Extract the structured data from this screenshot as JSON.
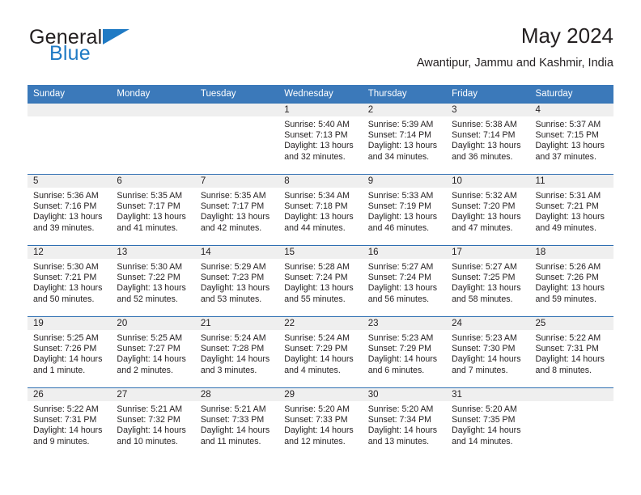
{
  "brand": {
    "name_part1": "General",
    "name_part2": "Blue",
    "triangle_color": "#1f7ac4"
  },
  "header": {
    "title": "May 2024",
    "subtitle": "Awantipur, Jammu and Kashmir, India"
  },
  "theme": {
    "header_blue": "#3b79ba",
    "row_border_blue": "#2f6fb2",
    "daynum_band": "#efefef",
    "text": "#231f20"
  },
  "weekday_headers": [
    "Sunday",
    "Monday",
    "Tuesday",
    "Wednesday",
    "Thursday",
    "Friday",
    "Saturday"
  ],
  "weeks": [
    [
      {
        "day": "",
        "sunrise": "",
        "sunset": "",
        "daylight_line1": "",
        "daylight_line2": "",
        "empty": true
      },
      {
        "day": "",
        "sunrise": "",
        "sunset": "",
        "daylight_line1": "",
        "daylight_line2": "",
        "empty": true
      },
      {
        "day": "",
        "sunrise": "",
        "sunset": "",
        "daylight_line1": "",
        "daylight_line2": "",
        "empty": true
      },
      {
        "day": "1",
        "sunrise": "Sunrise: 5:40 AM",
        "sunset": "Sunset: 7:13 PM",
        "daylight_line1": "Daylight: 13 hours",
        "daylight_line2": "and 32 minutes.",
        "empty": false
      },
      {
        "day": "2",
        "sunrise": "Sunrise: 5:39 AM",
        "sunset": "Sunset: 7:14 PM",
        "daylight_line1": "Daylight: 13 hours",
        "daylight_line2": "and 34 minutes.",
        "empty": false
      },
      {
        "day": "3",
        "sunrise": "Sunrise: 5:38 AM",
        "sunset": "Sunset: 7:14 PM",
        "daylight_line1": "Daylight: 13 hours",
        "daylight_line2": "and 36 minutes.",
        "empty": false
      },
      {
        "day": "4",
        "sunrise": "Sunrise: 5:37 AM",
        "sunset": "Sunset: 7:15 PM",
        "daylight_line1": "Daylight: 13 hours",
        "daylight_line2": "and 37 minutes.",
        "empty": false
      }
    ],
    [
      {
        "day": "5",
        "sunrise": "Sunrise: 5:36 AM",
        "sunset": "Sunset: 7:16 PM",
        "daylight_line1": "Daylight: 13 hours",
        "daylight_line2": "and 39 minutes.",
        "empty": false
      },
      {
        "day": "6",
        "sunrise": "Sunrise: 5:35 AM",
        "sunset": "Sunset: 7:17 PM",
        "daylight_line1": "Daylight: 13 hours",
        "daylight_line2": "and 41 minutes.",
        "empty": false
      },
      {
        "day": "7",
        "sunrise": "Sunrise: 5:35 AM",
        "sunset": "Sunset: 7:17 PM",
        "daylight_line1": "Daylight: 13 hours",
        "daylight_line2": "and 42 minutes.",
        "empty": false
      },
      {
        "day": "8",
        "sunrise": "Sunrise: 5:34 AM",
        "sunset": "Sunset: 7:18 PM",
        "daylight_line1": "Daylight: 13 hours",
        "daylight_line2": "and 44 minutes.",
        "empty": false
      },
      {
        "day": "9",
        "sunrise": "Sunrise: 5:33 AM",
        "sunset": "Sunset: 7:19 PM",
        "daylight_line1": "Daylight: 13 hours",
        "daylight_line2": "and 46 minutes.",
        "empty": false
      },
      {
        "day": "10",
        "sunrise": "Sunrise: 5:32 AM",
        "sunset": "Sunset: 7:20 PM",
        "daylight_line1": "Daylight: 13 hours",
        "daylight_line2": "and 47 minutes.",
        "empty": false
      },
      {
        "day": "11",
        "sunrise": "Sunrise: 5:31 AM",
        "sunset": "Sunset: 7:21 PM",
        "daylight_line1": "Daylight: 13 hours",
        "daylight_line2": "and 49 minutes.",
        "empty": false
      }
    ],
    [
      {
        "day": "12",
        "sunrise": "Sunrise: 5:30 AM",
        "sunset": "Sunset: 7:21 PM",
        "daylight_line1": "Daylight: 13 hours",
        "daylight_line2": "and 50 minutes.",
        "empty": false
      },
      {
        "day": "13",
        "sunrise": "Sunrise: 5:30 AM",
        "sunset": "Sunset: 7:22 PM",
        "daylight_line1": "Daylight: 13 hours",
        "daylight_line2": "and 52 minutes.",
        "empty": false
      },
      {
        "day": "14",
        "sunrise": "Sunrise: 5:29 AM",
        "sunset": "Sunset: 7:23 PM",
        "daylight_line1": "Daylight: 13 hours",
        "daylight_line2": "and 53 minutes.",
        "empty": false
      },
      {
        "day": "15",
        "sunrise": "Sunrise: 5:28 AM",
        "sunset": "Sunset: 7:24 PM",
        "daylight_line1": "Daylight: 13 hours",
        "daylight_line2": "and 55 minutes.",
        "empty": false
      },
      {
        "day": "16",
        "sunrise": "Sunrise: 5:27 AM",
        "sunset": "Sunset: 7:24 PM",
        "daylight_line1": "Daylight: 13 hours",
        "daylight_line2": "and 56 minutes.",
        "empty": false
      },
      {
        "day": "17",
        "sunrise": "Sunrise: 5:27 AM",
        "sunset": "Sunset: 7:25 PM",
        "daylight_line1": "Daylight: 13 hours",
        "daylight_line2": "and 58 minutes.",
        "empty": false
      },
      {
        "day": "18",
        "sunrise": "Sunrise: 5:26 AM",
        "sunset": "Sunset: 7:26 PM",
        "daylight_line1": "Daylight: 13 hours",
        "daylight_line2": "and 59 minutes.",
        "empty": false
      }
    ],
    [
      {
        "day": "19",
        "sunrise": "Sunrise: 5:25 AM",
        "sunset": "Sunset: 7:26 PM",
        "daylight_line1": "Daylight: 14 hours",
        "daylight_line2": "and 1 minute.",
        "empty": false
      },
      {
        "day": "20",
        "sunrise": "Sunrise: 5:25 AM",
        "sunset": "Sunset: 7:27 PM",
        "daylight_line1": "Daylight: 14 hours",
        "daylight_line2": "and 2 minutes.",
        "empty": false
      },
      {
        "day": "21",
        "sunrise": "Sunrise: 5:24 AM",
        "sunset": "Sunset: 7:28 PM",
        "daylight_line1": "Daylight: 14 hours",
        "daylight_line2": "and 3 minutes.",
        "empty": false
      },
      {
        "day": "22",
        "sunrise": "Sunrise: 5:24 AM",
        "sunset": "Sunset: 7:29 PM",
        "daylight_line1": "Daylight: 14 hours",
        "daylight_line2": "and 4 minutes.",
        "empty": false
      },
      {
        "day": "23",
        "sunrise": "Sunrise: 5:23 AM",
        "sunset": "Sunset: 7:29 PM",
        "daylight_line1": "Daylight: 14 hours",
        "daylight_line2": "and 6 minutes.",
        "empty": false
      },
      {
        "day": "24",
        "sunrise": "Sunrise: 5:23 AM",
        "sunset": "Sunset: 7:30 PM",
        "daylight_line1": "Daylight: 14 hours",
        "daylight_line2": "and 7 minutes.",
        "empty": false
      },
      {
        "day": "25",
        "sunrise": "Sunrise: 5:22 AM",
        "sunset": "Sunset: 7:31 PM",
        "daylight_line1": "Daylight: 14 hours",
        "daylight_line2": "and 8 minutes.",
        "empty": false
      }
    ],
    [
      {
        "day": "26",
        "sunrise": "Sunrise: 5:22 AM",
        "sunset": "Sunset: 7:31 PM",
        "daylight_line1": "Daylight: 14 hours",
        "daylight_line2": "and 9 minutes.",
        "empty": false
      },
      {
        "day": "27",
        "sunrise": "Sunrise: 5:21 AM",
        "sunset": "Sunset: 7:32 PM",
        "daylight_line1": "Daylight: 14 hours",
        "daylight_line2": "and 10 minutes.",
        "empty": false
      },
      {
        "day": "28",
        "sunrise": "Sunrise: 5:21 AM",
        "sunset": "Sunset: 7:33 PM",
        "daylight_line1": "Daylight: 14 hours",
        "daylight_line2": "and 11 minutes.",
        "empty": false
      },
      {
        "day": "29",
        "sunrise": "Sunrise: 5:20 AM",
        "sunset": "Sunset: 7:33 PM",
        "daylight_line1": "Daylight: 14 hours",
        "daylight_line2": "and 12 minutes.",
        "empty": false
      },
      {
        "day": "30",
        "sunrise": "Sunrise: 5:20 AM",
        "sunset": "Sunset: 7:34 PM",
        "daylight_line1": "Daylight: 14 hours",
        "daylight_line2": "and 13 minutes.",
        "empty": false
      },
      {
        "day": "31",
        "sunrise": "Sunrise: 5:20 AM",
        "sunset": "Sunset: 7:35 PM",
        "daylight_line1": "Daylight: 14 hours",
        "daylight_line2": "and 14 minutes.",
        "empty": false
      },
      {
        "day": "",
        "sunrise": "",
        "sunset": "",
        "daylight_line1": "",
        "daylight_line2": "",
        "empty": true
      }
    ]
  ]
}
